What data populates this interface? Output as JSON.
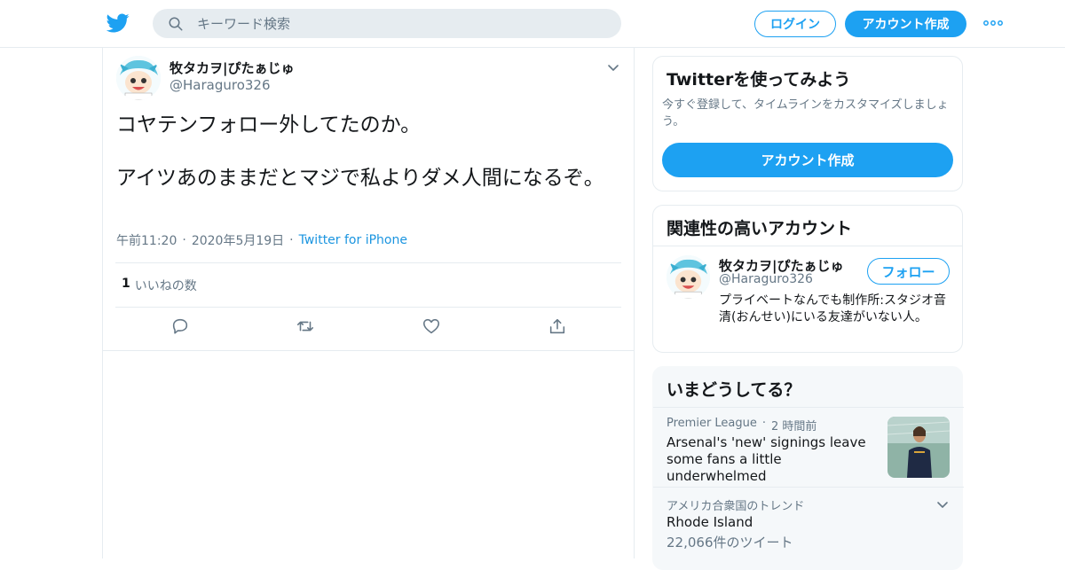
{
  "header": {
    "search_placeholder": "キーワード検索",
    "login_label": "ログイン",
    "signup_label": "アカウント作成"
  },
  "tweet": {
    "author_name": "牧タカヲ|ぴたぁじゅ",
    "author_handle": "@Haraguro326",
    "text": "コヤテンフォロー外してたのか。\n\nアイツあのままだとマジで私よりダメ人間になるぞ。",
    "time": "午前11:20",
    "date": "2020年5月19日",
    "source": "Twitter for iPhone",
    "like_count": "1",
    "like_label": "いいねの数"
  },
  "signup_card": {
    "title": "Twitterを使ってみよう",
    "description": "今すぐ登録して、タイムラインをカスタマイズしましょう。",
    "button_label": "アカウント作成"
  },
  "related_card": {
    "title": "関連性の高いアカウント",
    "account": {
      "name": "牧タカヲ|ぴたぁじゅ",
      "handle": "@Haraguro326",
      "bio": "プライベートなんでも制作所:スタジオ音清(おんせい)にいる友達がいない人。",
      "follow_label": "フォロー"
    }
  },
  "trends_card": {
    "title": "いまどうしてる？",
    "items": [
      {
        "source": "Premier League",
        "time": "2 時間前",
        "headline": "Arsenal's 'new' signings leave some fans a little underwhelmed"
      },
      {
        "context": "アメリカ合衆国のトレンド",
        "title": "Rhode Island",
        "count": "22,066件のツイート"
      }
    ]
  },
  "colors": {
    "brand_blue": "#1da1f2",
    "link_blue": "#1b95e0",
    "secondary_text": "#657786",
    "border": "#e6ecf0"
  }
}
